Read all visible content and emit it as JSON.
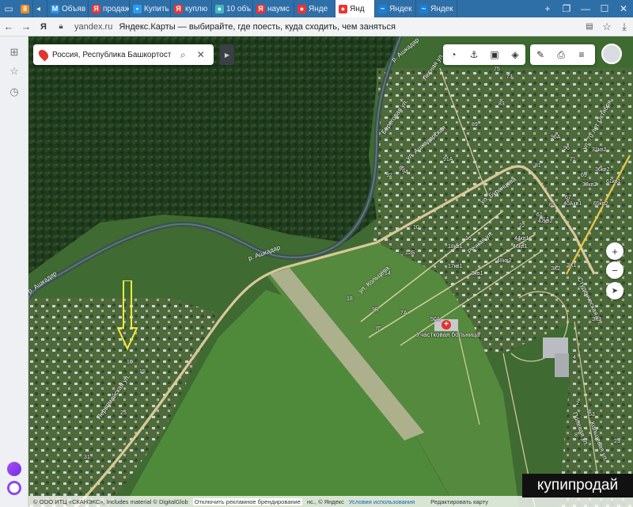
{
  "browser": {
    "tabs": [
      {
        "label": "Объяв",
        "fav": "М",
        "color": "#2c8ee6"
      },
      {
        "label": "продаж",
        "fav": "Я",
        "color": "#e33"
      },
      {
        "label": "Купить",
        "fav": "•",
        "color": "#2b9cf2"
      },
      {
        "label": "куплю",
        "fav": "Я",
        "color": "#e33"
      },
      {
        "label": "10 объ",
        "fav": "●",
        "color": "#42b7c4"
      },
      {
        "label": "наумс",
        "fav": "Я",
        "color": "#e33"
      },
      {
        "label": "Янде",
        "fav": "●",
        "color": "#e33"
      },
      {
        "label": "Янд",
        "fav": "●",
        "color": "#e33",
        "active": true
      },
      {
        "label": "Яндек",
        "fav": "~",
        "color": "#1a7fd6"
      },
      {
        "label": "Яндек",
        "fav": "~",
        "color": "#1a7fd6"
      }
    ],
    "first_tab_fav": "8",
    "address": {
      "domain": "yandex.ru",
      "title": "Яндекс.Карты — выбирайте, где поесть, куда сходить, чем заняться"
    }
  },
  "search": {
    "value": "Россия, Республика Башкортостан,"
  },
  "map": {
    "labels": [
      {
        "text": "р. Ашкадар"
      },
      {
        "text": "р. Ашкадар"
      },
      {
        "text": "р. Ашкадар"
      },
      {
        "text": "Береговая ул."
      },
      {
        "text": "ул. Ашкадарская"
      },
      {
        "text": "ул. Буранцева"
      },
      {
        "text": "Речная ул."
      },
      {
        "text": "ул. Кольцева"
      },
      {
        "text": "Первомайская ул."
      },
      {
        "text": "Лесная ул."
      },
      {
        "text": "ул. 70 лет Октября"
      },
      {
        "text": "Студенческая ул."
      },
      {
        "text": "Полевая ул."
      },
      {
        "text": "Кольцевая ул."
      }
    ],
    "poi": "Участковая больница",
    "numbers": [
      "94",
      "92",
      "95",
      "91А",
      "75",
      "73",
      "83",
      "89",
      "96А",
      "96",
      "81",
      "71",
      "69",
      "67",
      "63",
      "61",
      "1А",
      "10",
      "12Б",
      "14",
      "16",
      "18кв1",
      "17кв1",
      "5кв1",
      "50А",
      "9Б",
      "7А",
      "7Г",
      "18",
      "22",
      "44кв1",
      "48кв2",
      "46кв1",
      "42кв2",
      "40Акв1",
      "32кв2",
      "36кв2",
      "38кв2",
      "61кв1",
      "65кв2",
      "ЗК1",
      "ЗК2",
      "ЗК3",
      "10",
      "15",
      "25",
      "31",
      "2",
      "4",
      "53",
      "23",
      "8",
      "40"
    ]
  },
  "footer": {
    "copyright": "© ООО ИТЦ «СКАНЭКС», Includes material © DigitalGlob",
    "ads": "Отключить рекламное брендирование",
    "yandex": "нс., © Яндекс",
    "terms": "Условия использования",
    "edit": "Редактировать карту"
  },
  "watermark": "купипродай"
}
